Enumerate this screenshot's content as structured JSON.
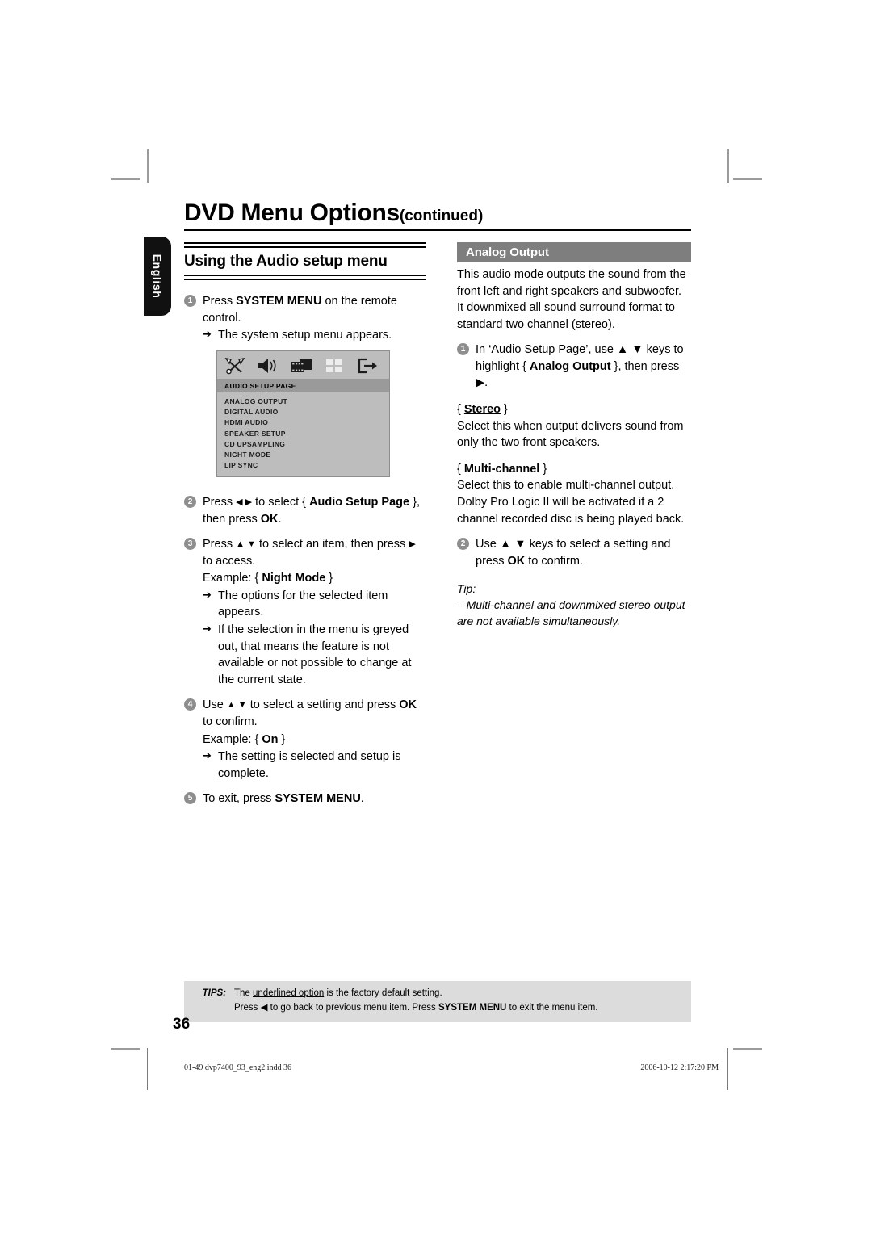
{
  "header": {
    "title_main": "DVD Menu Options",
    "title_suffix": "(continued)"
  },
  "language_tab": {
    "label": "English"
  },
  "left_column": {
    "section_title": "Using the Audio setup menu",
    "steps": [
      {
        "num": "1",
        "text_a": "Press ",
        "bold_b": "SYSTEM MENU",
        "text_c": " on the remote control.",
        "bullets": [
          "The system setup menu appears."
        ]
      },
      {
        "num": "2",
        "line": "Press ◀ ▶ to select { Audio Setup Page }, then press OK."
      },
      {
        "num": "3",
        "line": "Press ▲ ▼ to select an item, then press ▶ to access.",
        "example": "Example: { Night Mode }",
        "bullets": [
          "The options for the selected item appears.",
          "If the selection in the menu is greyed out, that means the feature is not available or not possible to change at the current state."
        ]
      },
      {
        "num": "4",
        "line": "Use ▲ ▼ to select a setting and press OK to confirm.",
        "example": "Example: { On }",
        "bullets": [
          "The setting is selected and setup is complete."
        ]
      },
      {
        "num": "5",
        "line": "To exit, press SYSTEM MENU."
      }
    ],
    "osd_screenshot": {
      "icons": [
        "tools-icon",
        "speaker-icon",
        "film-icon",
        "grid-icon",
        "exit-icon"
      ],
      "selected_tab": "AUDIO SETUP PAGE",
      "items": [
        "ANALOG OUTPUT",
        "DIGITAL AUDIO",
        "HDMI AUDIO",
        "SPEAKER SETUP",
        "CD UPSAMPLING",
        "NIGHT MODE",
        "LIP SYNC"
      ]
    }
  },
  "right_column": {
    "heading": "Analog Output",
    "intro": "This audio mode outputs the sound from the front left and right speakers and subwoofer. It downmixed all sound surround format to standard two channel (stereo).",
    "step1_num": "1",
    "step1_a": "In ‘Audio Setup Page’, use ▲ ▼ keys to highlight { ",
    "step1_bold": "Analog Output",
    "step1_c": " }, then press ▶.",
    "options": [
      {
        "label": "Stereo",
        "underlined": true,
        "body": "Select this when output delivers sound from only the two front speakers."
      },
      {
        "label": "Multi-channel",
        "underlined": false,
        "body": "Select this to enable multi-channel output. Dolby Pro Logic II will be activated if a 2 channel recorded disc is being played back."
      }
    ],
    "step2_num": "2",
    "step2_a": "Use ▲ ▼ keys to select a setting and press ",
    "step2_bold": "OK",
    "step2_c": " to confirm.",
    "tip_label": "Tip:",
    "tip_text": "– Multi-channel and downmixed stereo output are not available simultaneously."
  },
  "tips_footer": {
    "label": "TIPS:",
    "line1_a": "The ",
    "line1_u": "underlined option",
    "line1_c": " is the factory default setting.",
    "line2_a": "Press  ◀ to go back to previous menu item. Press ",
    "line2_bold": "SYSTEM MENU",
    "line2_c": " to exit the menu item."
  },
  "page_number": "36",
  "print_footer": {
    "file": "01-49 dvp7400_93_eng2.indd   36",
    "timestamp": "2006-10-12   2:17:20 PM"
  },
  "colors": {
    "grey_heading": "#7e7e7e",
    "osd_background": "#bdbdbd",
    "osd_selected": "#9a9a9a",
    "tips_background": "#dcdcdc",
    "step_bullet": "#8e8e8e"
  }
}
